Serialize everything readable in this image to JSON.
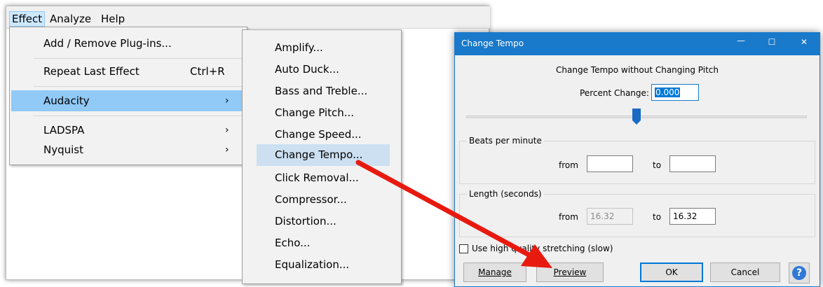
{
  "menubar": {
    "items": [
      "Effect",
      "Analyze",
      "Help"
    ]
  },
  "effect_menu": {
    "items": [
      {
        "label": "Add / Remove Plug-ins..."
      },
      {
        "label": "Repeat Last Effect",
        "shortcut": "Ctrl+R"
      },
      {
        "label": "Audacity",
        "arrow": "›",
        "highlighted": true
      },
      {
        "label": "LADSPA",
        "arrow": "›"
      },
      {
        "label": "Nyquist",
        "arrow": "›"
      }
    ]
  },
  "audacity_submenu": {
    "items": [
      "Amplify...",
      "Auto Duck...",
      "Bass and Treble...",
      "Change Pitch...",
      "Change Speed...",
      "Change Tempo...",
      "Click Removal...",
      "Compressor...",
      "Distortion...",
      "Echo...",
      "Equalization..."
    ],
    "highlighted_index": 5
  },
  "dialog": {
    "title": "Change Tempo",
    "titlebar_buttons": {
      "minimize": "—",
      "maximize": "☐",
      "close": "✕"
    },
    "heading": "Change Tempo without Changing Pitch",
    "percent_change": {
      "label": "Percent Change:",
      "value": "0.000"
    },
    "bpm_group": {
      "title": "Beats per minute",
      "from_label": "from",
      "to_label": "to",
      "from_value": "",
      "to_value": ""
    },
    "length_group": {
      "title": "Length (seconds)",
      "from_label": "from",
      "to_label": "to",
      "from_value": "16.32",
      "to_value": "16.32"
    },
    "checkbox_label": "Use high quality stretching (slow)",
    "buttons": {
      "manage": "Manage",
      "preview": "Preview",
      "ok": "OK",
      "cancel": "Cancel",
      "help": "?"
    }
  },
  "colors": {
    "titlebar": "#1979ca",
    "arrow": "#e8190f",
    "menu_highlight": "#91c9f7"
  }
}
